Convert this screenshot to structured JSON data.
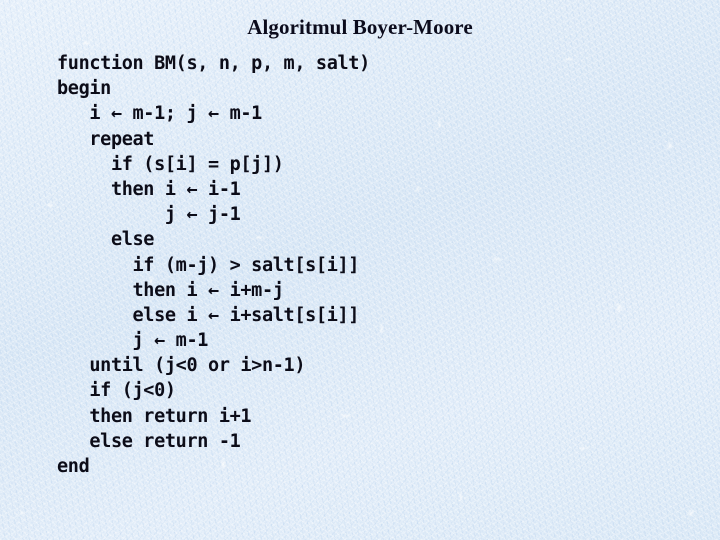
{
  "slide": {
    "title": "Algoritmul Boyer-Moore",
    "background_color": "#dce9f7",
    "text_color": "#0c0c18",
    "title_color": "#0b0b1c"
  },
  "code": {
    "language": "pseudocode",
    "assignment_operator": "←",
    "lines": [
      "function BM(s, n, p, m, salt)",
      "begin",
      "   i ← m-1; j ← m-1",
      "   repeat",
      "     if (s[i] = p[j])",
      "     then i ← i-1",
      "          j ← j-1",
      "     else",
      "       if (m-j) > salt[s[i]]",
      "       then i ← i+m-j",
      "       else i ← i+salt[s[i]]",
      "       j ← m-1",
      "   until (j<0 or i>n-1)",
      "   if (j<0)",
      "   then return i+1",
      "   else return -1",
      "end"
    ]
  }
}
